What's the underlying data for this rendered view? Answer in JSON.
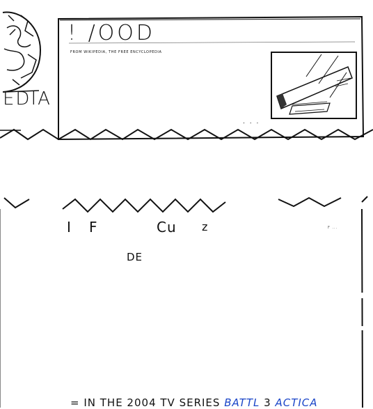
{
  "article": {
    "title": "! /OOD",
    "tagline": "FROM WIKIPEDIA, THE FREE ENCYCLOPEDIA",
    "ellipsis": ". . ."
  },
  "logo": {
    "wordmark": "EDIA",
    "icon": "puzzle-globe-icon"
  },
  "infobox": {
    "image": "wood-plank-sketch"
  },
  "fragments": {
    "a": "I",
    "b": "F",
    "c": "Cu",
    "d": "z",
    "e": "DE",
    "f": "F ..."
  },
  "footer_line": {
    "prefix": "= IN THE 2004 TV SERIES",
    "link_1": "BATTL",
    "middle": "3",
    "link_2": "ACTICA"
  },
  "colors": {
    "ink": "#111111",
    "link": "#1a45c8",
    "paper": "#ffffff"
  }
}
